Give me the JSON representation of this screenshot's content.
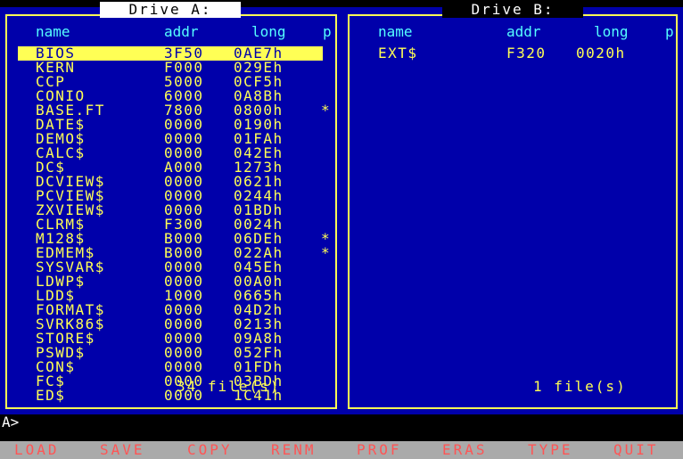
{
  "drive_a": {
    "title": "Drive A:",
    "headers": {
      "name": "name",
      "addr": "addr",
      "long": "long",
      "p": "p"
    },
    "files": [
      {
        "name": "BIOS",
        "addr": "3F50",
        "long": "0AE7h",
        "p": ""
      },
      {
        "name": "KERN",
        "addr": "F000",
        "long": "029Eh",
        "p": ""
      },
      {
        "name": "CCP",
        "addr": "5000",
        "long": "0CF5h",
        "p": ""
      },
      {
        "name": "CONIO",
        "addr": "6000",
        "long": "0A8Bh",
        "p": ""
      },
      {
        "name": "BASE.FT",
        "addr": "7800",
        "long": "0800h",
        "p": "*"
      },
      {
        "name": "DATE$",
        "addr": "0000",
        "long": "0190h",
        "p": ""
      },
      {
        "name": "DEMO$",
        "addr": "0000",
        "long": "01FAh",
        "p": ""
      },
      {
        "name": "CALC$",
        "addr": "0000",
        "long": "042Eh",
        "p": ""
      },
      {
        "name": "DC$",
        "addr": "A000",
        "long": "1273h",
        "p": ""
      },
      {
        "name": "DCVIEW$",
        "addr": "0000",
        "long": "0621h",
        "p": ""
      },
      {
        "name": "PCVIEW$",
        "addr": "0000",
        "long": "0244h",
        "p": ""
      },
      {
        "name": "ZXVIEW$",
        "addr": "0000",
        "long": "01BDh",
        "p": ""
      },
      {
        "name": "CLRM$",
        "addr": "F300",
        "long": "0024h",
        "p": ""
      },
      {
        "name": "M128$",
        "addr": "B000",
        "long": "06DEh",
        "p": "*"
      },
      {
        "name": "EDMEM$",
        "addr": "B000",
        "long": "022Ah",
        "p": "*"
      },
      {
        "name": "SYSVAR$",
        "addr": "0000",
        "long": "045Eh",
        "p": ""
      },
      {
        "name": "LDWP$",
        "addr": "0000",
        "long": "00A0h",
        "p": ""
      },
      {
        "name": "LDD$",
        "addr": "1000",
        "long": "0665h",
        "p": ""
      },
      {
        "name": "FORMAT$",
        "addr": "0000",
        "long": "04D2h",
        "p": ""
      },
      {
        "name": "SVRK86$",
        "addr": "0000",
        "long": "0213h",
        "p": ""
      },
      {
        "name": "STORE$",
        "addr": "0000",
        "long": "09A8h",
        "p": ""
      },
      {
        "name": "PSWD$",
        "addr": "0000",
        "long": "052Fh",
        "p": ""
      },
      {
        "name": "CON$",
        "addr": "0000",
        "long": "01FDh",
        "p": ""
      },
      {
        "name": "FC$",
        "addr": "0000",
        "long": "03BDh",
        "p": ""
      },
      {
        "name": "ED$",
        "addr": "0000",
        "long": "1C41h",
        "p": ""
      }
    ],
    "count_label": "34 file(s)"
  },
  "drive_b": {
    "title": "Drive B:",
    "headers": {
      "name": "name",
      "addr": "addr",
      "long": "long",
      "p": "p"
    },
    "files": [
      {
        "name": "EXT$",
        "addr": "F320",
        "long": "0020h",
        "p": ""
      }
    ],
    "count_label": "1 file(s)"
  },
  "cmdline": {
    "prompt": "A>"
  },
  "fkeys": [
    {
      "label": "LOAD"
    },
    {
      "label": "SAVE"
    },
    {
      "label": "COPY"
    },
    {
      "label": "RENM"
    },
    {
      "label": "PROF"
    },
    {
      "label": "ERAS"
    },
    {
      "label": "TYPE"
    },
    {
      "label": "QUIT"
    }
  ],
  "colors": {
    "panel_bg": "#0000aa",
    "file_text": "#ffff55",
    "header_text": "#55ffff",
    "selection_bg": "#ffff55",
    "fkey_bar": "#aaaaaa",
    "fkey_text": "#ff5555"
  }
}
